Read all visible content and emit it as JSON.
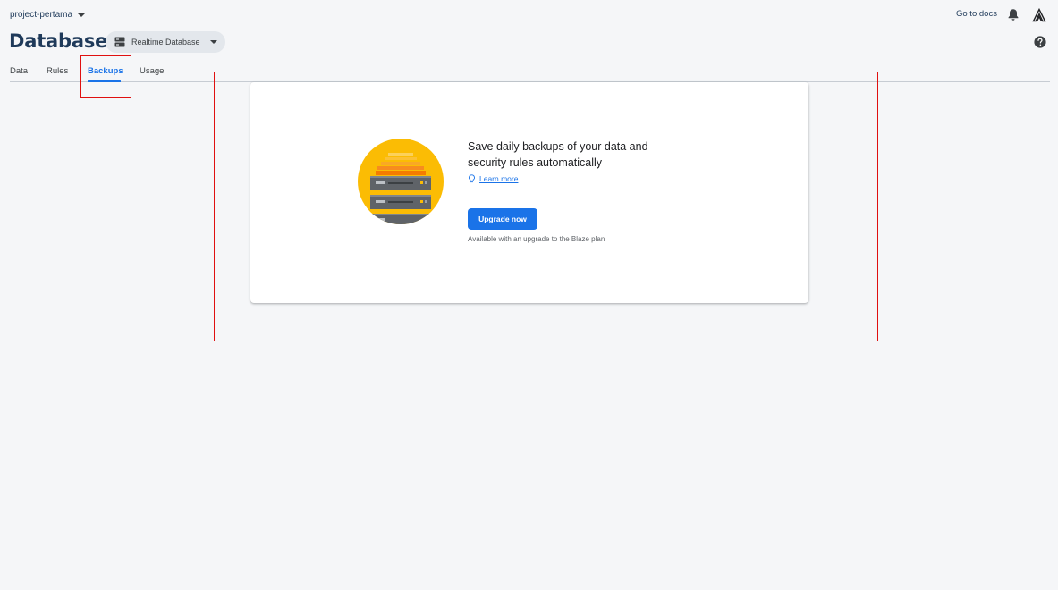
{
  "header": {
    "project_name": "project-pertama",
    "docs_link": "Go to docs"
  },
  "page": {
    "title": "Database",
    "database_selector": "Realtime Database"
  },
  "tabs": [
    {
      "label": "Data",
      "active": false
    },
    {
      "label": "Rules",
      "active": false
    },
    {
      "label": "Backups",
      "active": true
    },
    {
      "label": "Usage",
      "active": false
    }
  ],
  "backups_card": {
    "headline": "Save daily backups of your data and security rules automatically",
    "learn_more": "Learn more",
    "upgrade_button": "Upgrade now",
    "availability_note": "Available with an upgrade to the Blaze plan"
  },
  "colors": {
    "accent": "#1a73e8",
    "highlight": "#e01010",
    "illustration_bg": "#fbbc04"
  }
}
